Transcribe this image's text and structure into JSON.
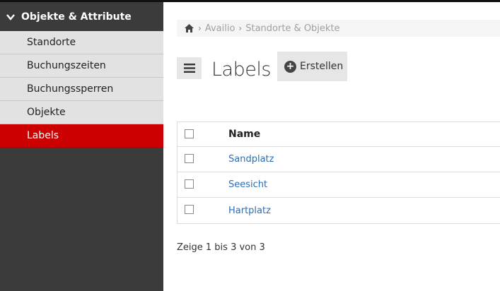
{
  "sidebar": {
    "section_title": "Objekte & Attribute",
    "items": [
      {
        "label": "Standorte",
        "active": false
      },
      {
        "label": "Buchungszeiten",
        "active": false
      },
      {
        "label": "Buchungssperren",
        "active": false
      },
      {
        "label": "Objekte",
        "active": false
      },
      {
        "label": "Labels",
        "active": true
      }
    ]
  },
  "breadcrumb": {
    "home_icon": "home-icon",
    "items": [
      "Availio",
      "Standorte & Objekte"
    ]
  },
  "header": {
    "title": "Labels",
    "create_label": "Erstellen",
    "menu_icon": "hamburger-icon"
  },
  "table": {
    "column_name": "Name",
    "rows": [
      {
        "name": "Sandplatz"
      },
      {
        "name": "Seesicht"
      },
      {
        "name": "Hartplatz"
      }
    ]
  },
  "footer": {
    "info": "Zeige 1 bis 3 von 3"
  },
  "colors": {
    "accent": "#cc0000",
    "link": "#2a6db5",
    "sidebar_bg": "#3b3b3b"
  }
}
